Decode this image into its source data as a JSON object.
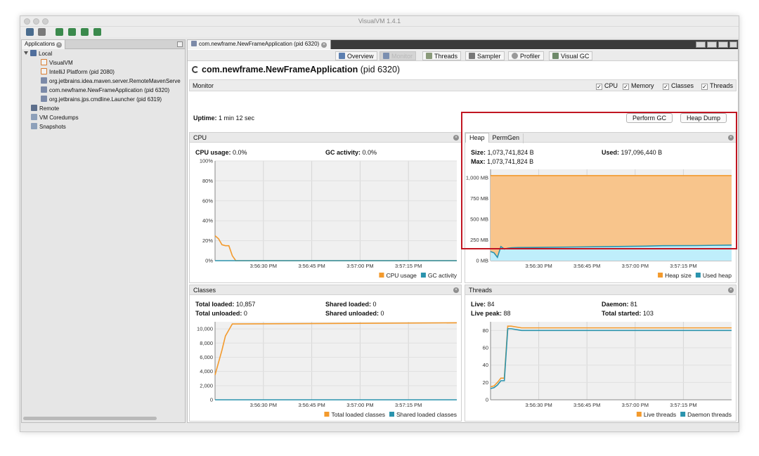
{
  "window": {
    "title": "VisualVM 1.4.1"
  },
  "colors": {
    "orange": "#f39a2d",
    "blue": "#2a93ad",
    "heap_fill": "#f8c58c",
    "used_fill": "#bfeefb"
  },
  "left": {
    "tab_label": "Applications",
    "local": "Local",
    "local_items": [
      "VisualVM",
      "IntelliJ Platform (pid 2080)",
      "org.jetbrains.idea.maven.server.RemoteMavenServe",
      "com.newframe.NewFrameApplication (pid 6320)",
      "org.jetbrains.jps.cmdline.Launcher (pid 6319)"
    ],
    "remote": "Remote",
    "coredumps": "VM Coredumps",
    "snapshots": "Snapshots"
  },
  "right": {
    "doc_tab": "com.newframe.NewFrameApplication (pid 6320)",
    "subtabs": [
      "Overview",
      "Monitor",
      "Threads",
      "Sampler",
      "Profiler",
      "Visual GC"
    ],
    "app_title": "com.newframe.NewFrameApplication",
    "app_pid": "(pid 6320)",
    "monitor_label": "Monitor",
    "checks": [
      "CPU",
      "Memory",
      "Classes",
      "Threads"
    ],
    "uptime_label": "Uptime:",
    "uptime_value": "1 min 12 sec",
    "perform_gc": "Perform GC",
    "heap_dump": "Heap Dump"
  },
  "cpu": {
    "title": "CPU",
    "usage_label": "CPU usage:",
    "usage_value": "0.0%",
    "gc_label": "GC activity:",
    "gc_value": "0.0%",
    "legend": [
      "CPU usage",
      "GC activity"
    ]
  },
  "heap": {
    "tabs": [
      "Heap",
      "PermGen"
    ],
    "size_label": "Size:",
    "size_value": "1,073,741,824 B",
    "used_label": "Used:",
    "used_value": "197,096,440 B",
    "max_label": "Max:",
    "max_value": "1,073,741,824 B",
    "legend": [
      "Heap size",
      "Used heap"
    ]
  },
  "classes": {
    "title": "Classes",
    "total_loaded_label": "Total loaded:",
    "total_loaded_value": "10,857",
    "shared_loaded_label": "Shared loaded:",
    "shared_loaded_value": "0",
    "total_unloaded_label": "Total unloaded:",
    "total_unloaded_value": "0",
    "shared_unloaded_label": "Shared unloaded:",
    "shared_unloaded_value": "0",
    "legend": [
      "Total loaded classes",
      "Shared loaded classes"
    ]
  },
  "threads": {
    "title": "Threads",
    "live_label": "Live:",
    "live_value": "84",
    "daemon_label": "Daemon:",
    "daemon_value": "81",
    "peak_label": "Live peak:",
    "peak_value": "88",
    "started_label": "Total started:",
    "started_value": "103",
    "legend": [
      "Live threads",
      "Daemon threads"
    ]
  },
  "chart_data": [
    {
      "id": "cpu",
      "type": "line",
      "x_ticks": [
        "3:56:30 PM",
        "3:56:45 PM",
        "3:57:00 PM",
        "3:57:15 PM"
      ],
      "y_ticks": [
        "0%",
        "20%",
        "40%",
        "60%",
        "80%",
        "100%"
      ],
      "ylim": [
        0,
        100
      ],
      "xlim": [
        0,
        70
      ],
      "series": [
        {
          "name": "CPU usage",
          "color": "#f39a2d",
          "x": [
            0,
            1,
            2,
            3,
            4,
            5,
            6,
            70
          ],
          "y": [
            25,
            22,
            16,
            15,
            15,
            5,
            0,
            0
          ]
        },
        {
          "name": "GC activity",
          "color": "#2a93ad",
          "x": [
            0,
            70
          ],
          "y": [
            0,
            0
          ]
        }
      ]
    },
    {
      "id": "heap",
      "type": "area",
      "x_ticks": [
        "3:56:30 PM",
        "3:56:45 PM",
        "3:57:00 PM",
        "3:57:15 PM"
      ],
      "y_ticks": [
        "0 MB",
        "250 MB",
        "500 MB",
        "750 MB",
        "1,000 MB"
      ],
      "ylim": [
        0,
        1100
      ],
      "xlim": [
        0,
        70
      ],
      "series": [
        {
          "name": "Heap size",
          "color": "#f39a2d",
          "x": [
            0,
            70
          ],
          "y": [
            1024,
            1024
          ]
        },
        {
          "name": "Used heap",
          "color": "#2a93ad",
          "x": [
            0,
            1,
            2,
            3,
            4,
            5,
            6,
            8,
            15,
            25,
            35,
            45,
            50,
            60,
            65,
            70
          ],
          "y": [
            110,
            95,
            40,
            170,
            140,
            150,
            155,
            158,
            160,
            165,
            170,
            175,
            180,
            182,
            185,
            188
          ]
        }
      ]
    },
    {
      "id": "classes",
      "type": "line",
      "x_ticks": [
        "3:56:30 PM",
        "3:56:45 PM",
        "3:57:00 PM",
        "3:57:15 PM"
      ],
      "y_ticks": [
        "0",
        "2,000",
        "4,000",
        "6,000",
        "8,000",
        "10,000"
      ],
      "ylim": [
        0,
        11000
      ],
      "xlim": [
        0,
        70
      ],
      "series": [
        {
          "name": "Total loaded classes",
          "color": "#f39a2d",
          "x": [
            0,
            2,
            3,
            5,
            70
          ],
          "y": [
            3500,
            7000,
            9000,
            10700,
            10857
          ]
        },
        {
          "name": "Shared loaded classes",
          "color": "#2a93ad",
          "x": [
            0,
            70
          ],
          "y": [
            0,
            0
          ]
        }
      ]
    },
    {
      "id": "threads",
      "type": "line",
      "x_ticks": [
        "3:56:30 PM",
        "3:56:45 PM",
        "3:57:00 PM",
        "3:57:15 PM"
      ],
      "y_ticks": [
        "0",
        "20",
        "40",
        "60",
        "80"
      ],
      "ylim": [
        0,
        90
      ],
      "xlim": [
        0,
        70
      ],
      "series": [
        {
          "name": "Live threads",
          "color": "#f39a2d",
          "x": [
            0,
            1,
            2,
            3,
            4,
            5,
            6,
            9,
            70
          ],
          "y": [
            15,
            16,
            20,
            25,
            25,
            85,
            85,
            83,
            83
          ]
        },
        {
          "name": "Daemon threads",
          "color": "#2a93ad",
          "x": [
            0,
            1,
            2,
            3,
            4,
            5,
            6,
            9,
            70
          ],
          "y": [
            13,
            14,
            17,
            22,
            22,
            82,
            82,
            80,
            80
          ]
        }
      ]
    }
  ]
}
